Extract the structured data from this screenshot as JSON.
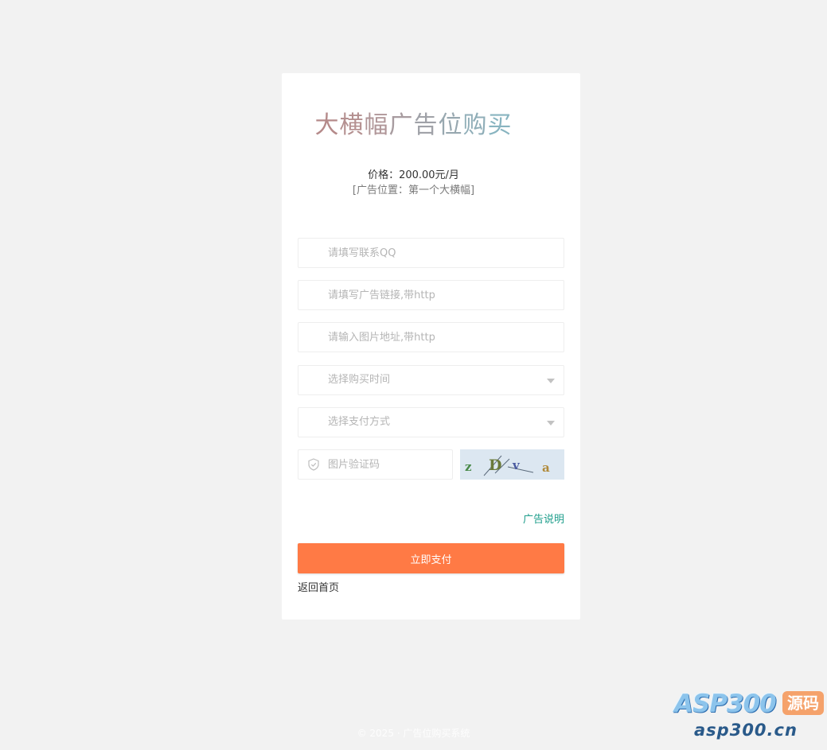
{
  "card": {
    "title_chars": [
      {
        "char": "大",
        "color": "#b58a8a"
      },
      {
        "char": "横",
        "color": "#b49090"
      },
      {
        "char": "幅",
        "color": "#b09698"
      },
      {
        "char": "广",
        "color": "#a89ca0"
      },
      {
        "char": "告",
        "color": "#a0a2a8"
      },
      {
        "char": "位",
        "color": "#98a8b0"
      },
      {
        "char": "购",
        "color": "#90aeb8"
      },
      {
        "char": "买",
        "color": "#88b4c0"
      }
    ],
    "price_text": "价格：200.00元/月",
    "position_text": "[广告位置：第一个大横幅]"
  },
  "form": {
    "qq_placeholder": "请填写联系QQ",
    "link_placeholder": "请填写广告链接,带http",
    "image_placeholder": "请输入图片地址,带http",
    "duration_placeholder": "选择购买时间",
    "payment_placeholder": "选择支付方式",
    "captcha_placeholder": "图片验证码",
    "captcha_text": "zDv a"
  },
  "links": {
    "help": "广告说明",
    "back": "返回首页"
  },
  "buttons": {
    "pay": "立即支付"
  },
  "footer": {
    "text": "© 2025 · 广告位购买系统"
  },
  "watermark": {
    "brand": "ASP300",
    "badge": "源码",
    "url": "asp300.cn"
  },
  "colors": {
    "page_bg": "#f2f2f2",
    "card_bg": "#ffffff",
    "accent_button": "#ff7a45",
    "help_link": "#1f9e8c"
  }
}
